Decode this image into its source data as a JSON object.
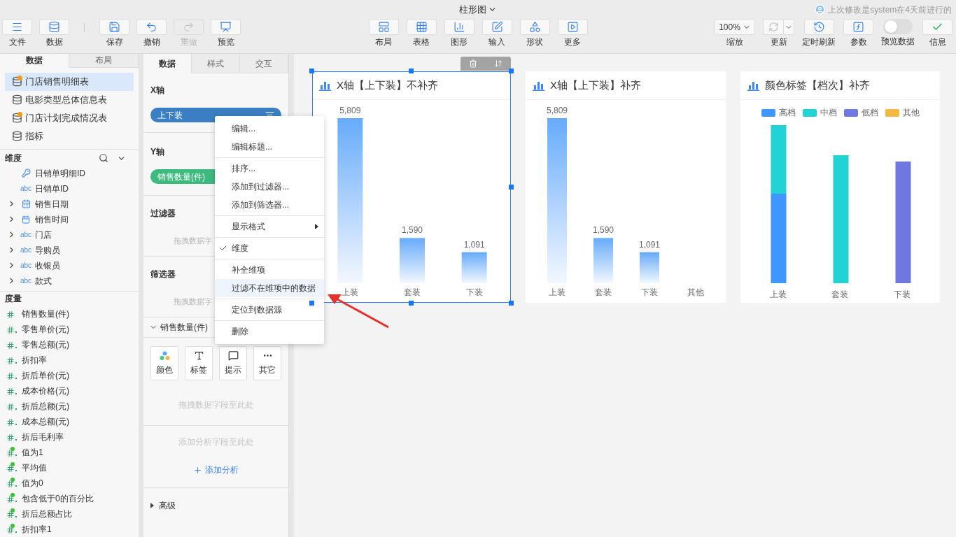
{
  "title": "柱形图",
  "last_modified": "上次修改是system在4天前进行的",
  "toolbar_left": [
    {
      "label": "文件",
      "disabled": false
    },
    {
      "label": "数据",
      "disabled": false
    },
    {
      "label": "保存",
      "disabled": false
    },
    {
      "label": "撤销",
      "disabled": false
    },
    {
      "label": "重做",
      "disabled": true
    },
    {
      "label": "预览",
      "disabled": false
    }
  ],
  "toolbar_center": [
    {
      "label": "布局"
    },
    {
      "label": "表格"
    },
    {
      "label": "图形"
    },
    {
      "label": "输入"
    },
    {
      "label": "形状"
    },
    {
      "label": "更多"
    }
  ],
  "toolbar_right": {
    "zoom": {
      "value": "100%",
      "label": "缩放"
    },
    "refresh": {
      "label": "更新"
    },
    "timed_refresh": {
      "label": "定时刷新"
    },
    "params": {
      "label": "参数"
    },
    "preview_data": {
      "label": "预览数据",
      "on": false
    },
    "info": {
      "label": "信息"
    }
  },
  "left_panel": {
    "tabs": [
      {
        "label": "数据",
        "selected": true
      },
      {
        "label": "布局",
        "selected": false
      }
    ],
    "sources": [
      {
        "name": "门店销售明细表",
        "flagged": true,
        "selected": true
      },
      {
        "name": "电影类型总体信息表",
        "flagged": false,
        "selected": false
      },
      {
        "name": "门店计划完成情况表",
        "flagged": true,
        "selected": false
      },
      {
        "name": "指标",
        "flagged": false,
        "selected": false
      }
    ],
    "dimensions": {
      "title": "维度",
      "fields": [
        {
          "name": "日销单明细ID",
          "kind": "key",
          "expandable": false
        },
        {
          "name": "日销单ID",
          "kind": "text",
          "type_label": "abc",
          "expandable": false
        },
        {
          "name": "销售日期",
          "kind": "date",
          "expandable": true
        },
        {
          "name": "销售时间",
          "kind": "time",
          "expandable": true
        },
        {
          "name": "门店",
          "kind": "text",
          "type_label": "abc",
          "expandable": true
        },
        {
          "name": "导购员",
          "kind": "text",
          "type_label": "abc",
          "expandable": true
        },
        {
          "name": "收银员",
          "kind": "text",
          "type_label": "abc",
          "expandable": true
        },
        {
          "name": "款式",
          "kind": "text",
          "type_label": "abc",
          "expandable": true
        }
      ]
    },
    "measures": {
      "title": "度量",
      "fields": [
        {
          "name": "销售数量(件)",
          "kind": "integer"
        },
        {
          "name": "零售单价(元)",
          "kind": "decimal"
        },
        {
          "name": "零售总额(元)",
          "kind": "decimal"
        },
        {
          "name": "折扣率",
          "kind": "decimal"
        },
        {
          "name": "折后单价(元)",
          "kind": "decimal"
        },
        {
          "name": "成本价格(元)",
          "kind": "decimal"
        },
        {
          "name": "折后总额(元)",
          "kind": "decimal"
        },
        {
          "name": "成本总额(元)",
          "kind": "decimal"
        },
        {
          "name": "折后毛利率",
          "kind": "decimal"
        },
        {
          "name": "值为1",
          "kind": "calc"
        },
        {
          "name": "平均值",
          "kind": "calc"
        },
        {
          "name": "值为0",
          "kind": "calc"
        },
        {
          "name": "包含低于0的百分比",
          "kind": "calc"
        },
        {
          "name": "折后总额占比",
          "kind": "calc"
        },
        {
          "name": "折扣率1",
          "kind": "calc"
        }
      ]
    }
  },
  "config_panel": {
    "tabs": [
      {
        "label": "数据",
        "selected": true
      },
      {
        "label": "样式",
        "selected": false
      },
      {
        "label": "交互",
        "selected": false
      }
    ],
    "x_axis": {
      "title": "X轴",
      "field": "上下装"
    },
    "y_axis": {
      "title": "Y轴",
      "field": "销售数量(件)"
    },
    "filter": {
      "title": "过滤器",
      "hint": "拖拽数据字"
    },
    "selector": {
      "title": "筛选器",
      "hint": "拖拽数据字"
    },
    "measure_section": {
      "title": "销售数量(件)",
      "expanded": true,
      "buttons": [
        {
          "label": "颜色",
          "kind": "color"
        },
        {
          "label": "标签",
          "kind": "label"
        },
        {
          "label": "提示",
          "kind": "tooltip"
        },
        {
          "label": "其它",
          "kind": "more"
        }
      ],
      "hint": "拖拽数据字段至此处"
    },
    "analysis": {
      "hint": "添加分析字段至此处",
      "add": "添加分析"
    },
    "advanced": {
      "title": "高级",
      "expanded": false
    }
  },
  "context_menu": {
    "groups": [
      [
        {
          "label": "编辑...",
          "checked": false,
          "submenu": false,
          "highlighted": false
        },
        {
          "label": "编辑标题...",
          "checked": false,
          "submenu": false,
          "highlighted": false
        }
      ],
      [
        {
          "label": "排序...",
          "checked": false,
          "submenu": false,
          "highlighted": false
        },
        {
          "label": "添加到过滤器...",
          "checked": false,
          "submenu": false,
          "highlighted": false
        },
        {
          "label": "添加到筛选器...",
          "checked": false,
          "submenu": false,
          "highlighted": false
        }
      ],
      [
        {
          "label": "显示格式",
          "checked": false,
          "submenu": true,
          "highlighted": false
        }
      ],
      [
        {
          "label": "维度",
          "checked": true,
          "submenu": false,
          "highlighted": false
        }
      ],
      [
        {
          "label": "补全维项",
          "checked": false,
          "submenu": false,
          "highlighted": false
        },
        {
          "label": "过滤不在维项中的数据",
          "checked": false,
          "submenu": false,
          "highlighted": true
        }
      ],
      [
        {
          "label": "定位到数据源",
          "checked": false,
          "submenu": false,
          "highlighted": false
        }
      ],
      [
        {
          "label": "删除",
          "checked": false,
          "submenu": false,
          "highlighted": false
        }
      ]
    ]
  },
  "charts": [
    {
      "kind": "bar",
      "title": "X轴【上下装】不补齐",
      "selected": true,
      "chart_data": {
        "type": "bar",
        "categories": [
          "上装",
          "套装",
          "下装"
        ],
        "values": [
          5809,
          1590,
          1091
        ],
        "data_labels": "value_labels",
        "value_labels": [
          "5,809",
          "1,590",
          "1,091"
        ]
      }
    },
    {
      "kind": "bar",
      "title": "X轴【上下装】补齐",
      "selected": false,
      "chart_data": {
        "type": "bar",
        "categories": [
          "上装",
          "套装",
          "下装",
          "其他"
        ],
        "values": [
          5809,
          1590,
          1091,
          null
        ],
        "data_labels": "value_labels",
        "value_labels": [
          "5,809",
          "1,590",
          "1,091",
          null
        ]
      }
    },
    {
      "kind": "stacked",
      "title": "颜色标签【档次】补齐",
      "selected": false,
      "legend": [
        {
          "label": "高档",
          "color": "#4096ff"
        },
        {
          "label": "中档",
          "color": "#22d3d6"
        },
        {
          "label": "低档",
          "color": "#6f78e0"
        },
        {
          "label": "其他",
          "color": "#f5b942"
        }
      ],
      "categories": [
        "上装",
        "套装",
        "下装"
      ]
    }
  ]
}
